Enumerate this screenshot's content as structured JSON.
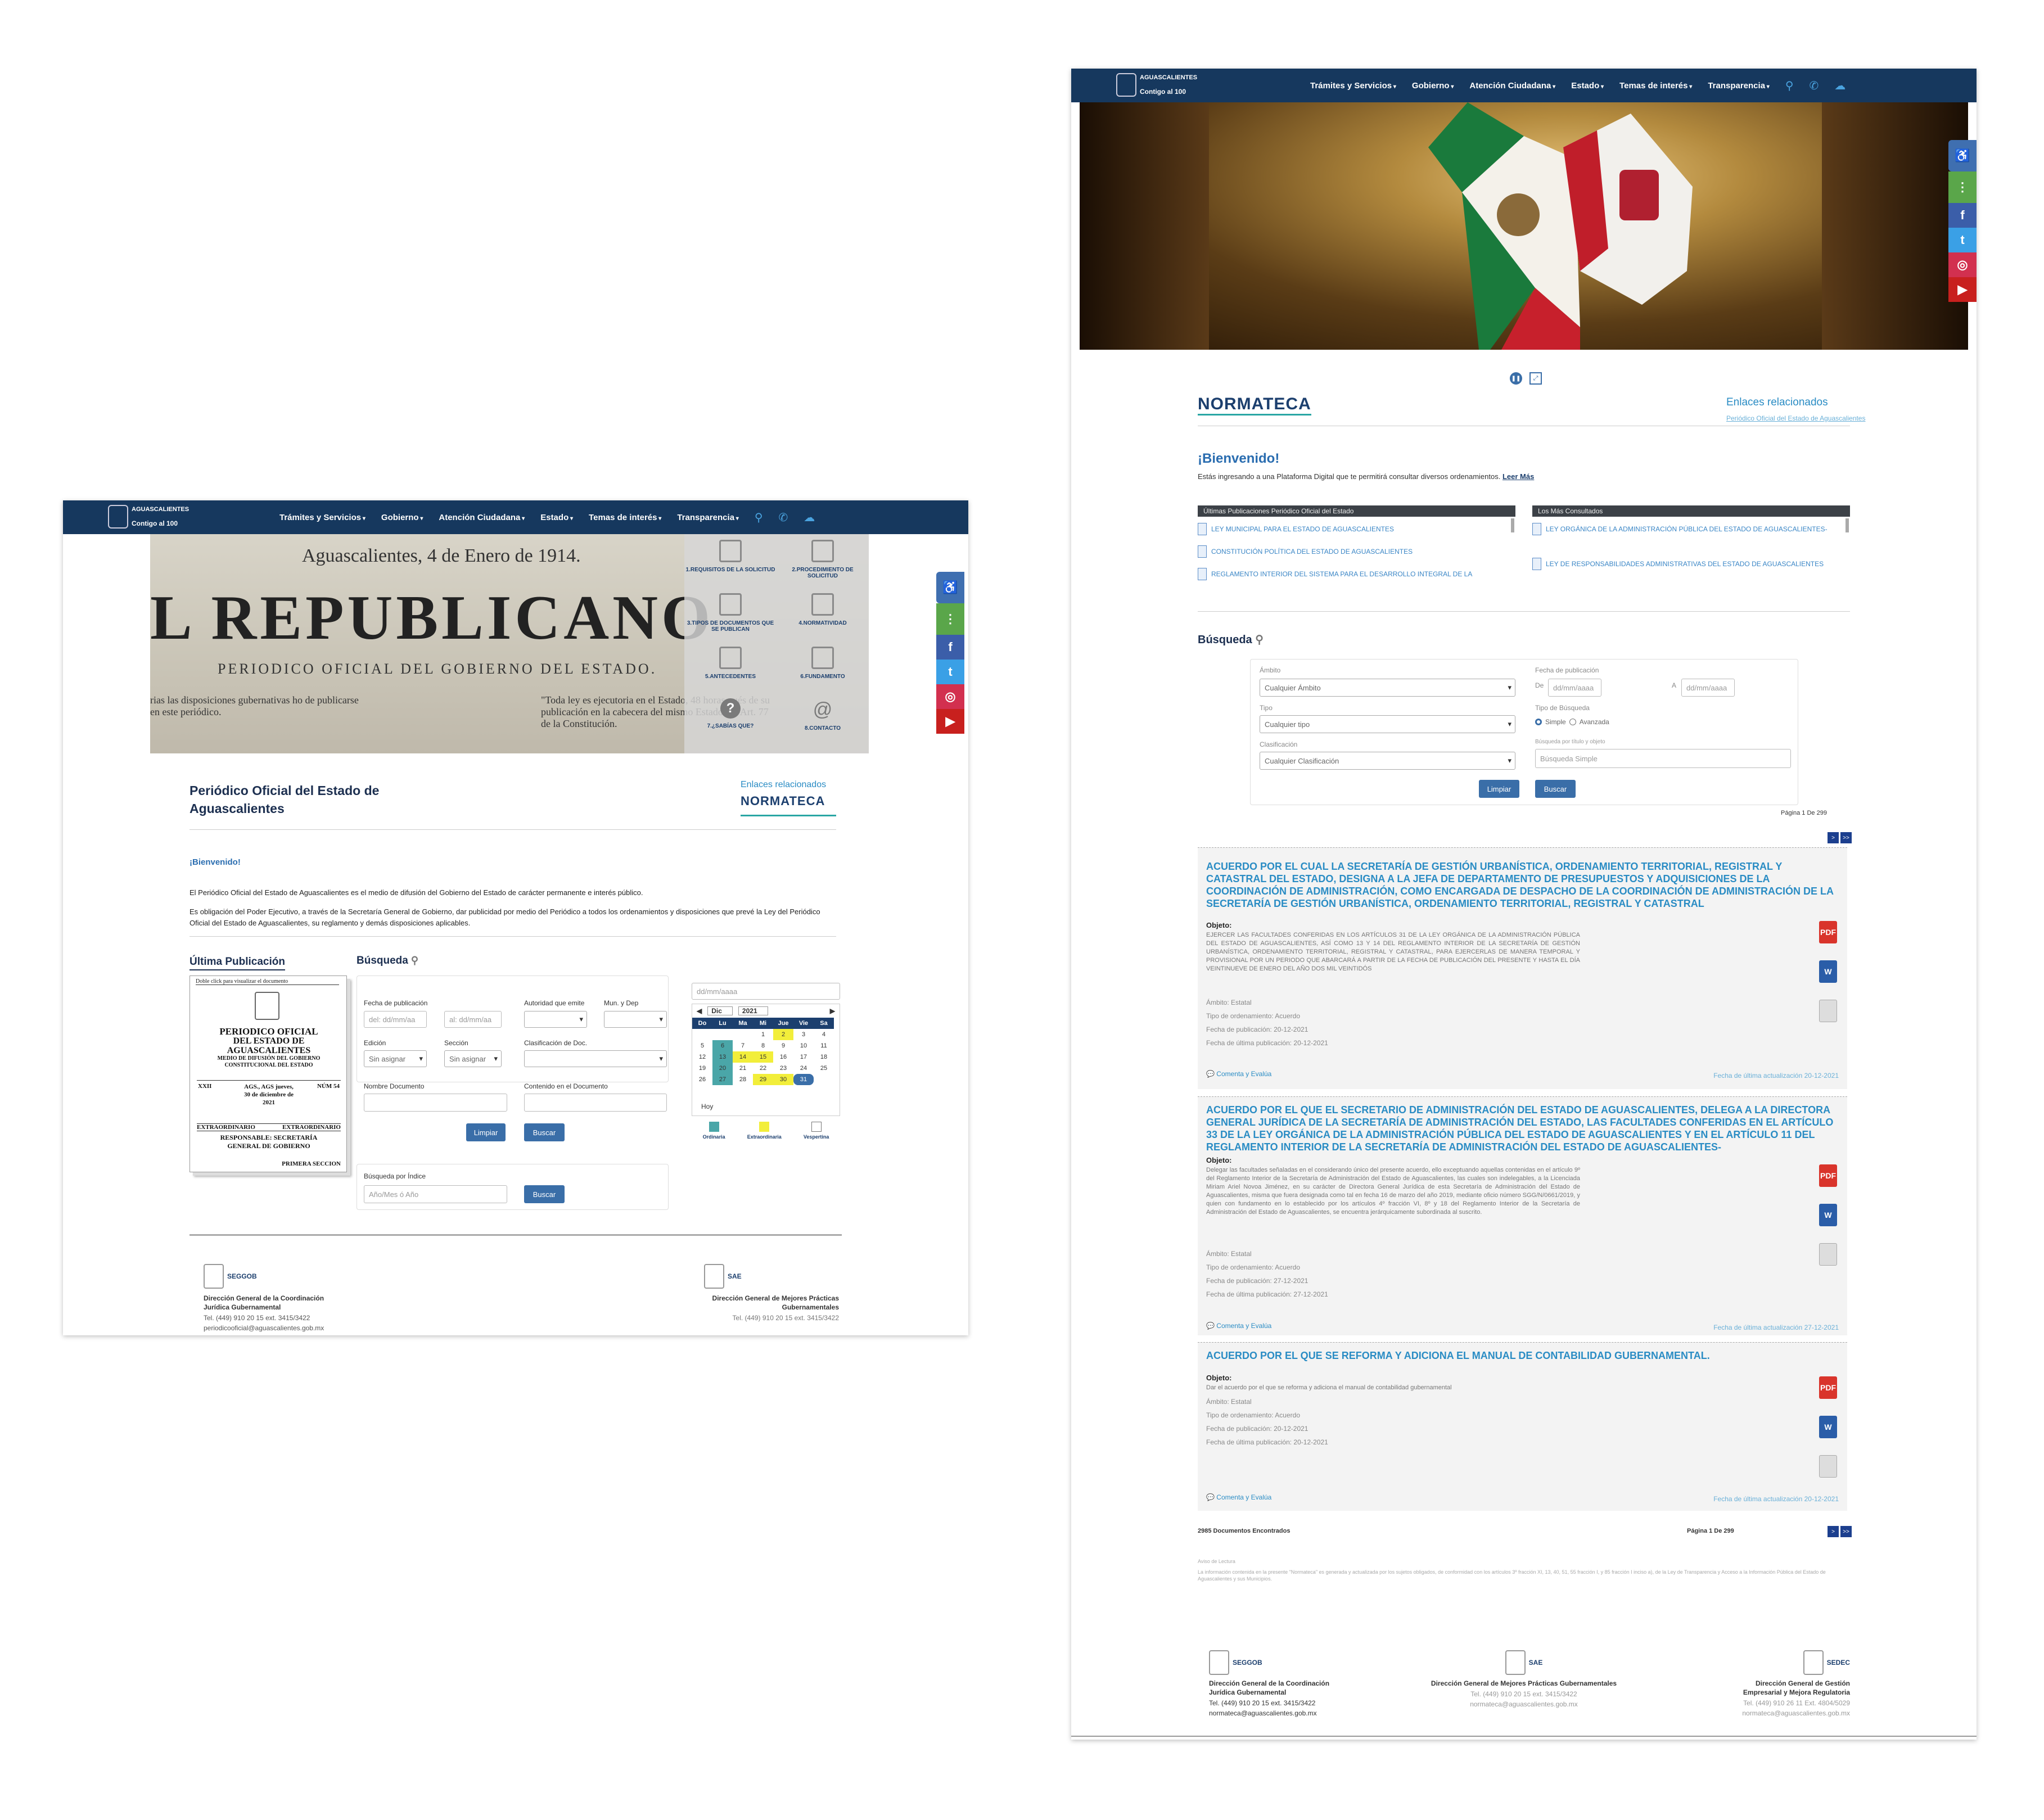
{
  "nav": {
    "brand_top": "AGUASCALIENTES",
    "brand_bottom": "Contigo al 100",
    "items": [
      "Trámites y Servicios",
      "Gobierno",
      "Atención Ciudadana",
      "Estado",
      "Temas de interés",
      "Transparencia"
    ]
  },
  "periodico": {
    "banner_date": "Aguascalientes, 4 de Enero de 1914.",
    "banner_head": "L REPUBLICANO",
    "banner_sub": "PERIODICO OFICIAL DEL GOBIERNO DEL ESTADO.",
    "banner_left": "rias las disposiciones gubernativas ho de publicarse en este periódico.",
    "banner_right": "\"Toda ley es ejecutoria en el Estado, 48 horas pués de su publicación en la cabecera del mismo Estado.\"—Art. 77 de la Constitución.",
    "tiles": [
      "1.REQUISITOS DE LA SOLICITUD",
      "2.PROCEDIMIENTO DE SOLICITUD",
      "3.TIPOS DE DOCUMENTOS QUE SE PUBLICAN",
      "4.NORMATIVIDAD",
      "5.ANTECEDENTES",
      "6.FUNDAMENTO",
      "7.¿SABÍAS QUE?",
      "8.CONTACTO"
    ],
    "title_line1": "Periódico Oficial del Estado de",
    "title_line2": "Aguascalientes",
    "related": "Enlaces relacionados",
    "normateca": "NORMATECA",
    "welcome": "¡Bienvenido!",
    "intro1": "El Periódico Oficial del Estado de Aguascalientes es el medio de difusión del Gobierno del Estado de carácter permanente e interés público.",
    "intro2": "Es obligación del Poder Ejecutivo, a través de la Secretaría General de Gobierno, dar publicidad por medio del Periódico a todos los ordenamientos y disposiciones que prevé la Ley del Periódico Oficial del Estado de Aguascalientes, su reglamento y demás disposiciones aplicables.",
    "ultima": "Última Publicación",
    "busqueda": "Búsqueda",
    "doc": {
      "hint": "Doble click para visualizar el documento",
      "t1": "PERIODICO OFICIAL",
      "t2": "DEL ESTADO DE",
      "t3": "AGUASCALIENTES",
      "t4": "MEDIO DE DIFUSIÓN DEL GOBIERNO CONSTITUCIONAL DEL ESTADO",
      "left": "XXII",
      "mid": "AGS., AGS jueves, 30 de diciembre de 2021",
      "right": "NÚM 54",
      "ext1": "EXTRAORDINARIO",
      "ext2": "EXTRAORDINARIO",
      "resp": "RESPONSABLE: SECRETARÍA GENERAL DE GOBIERNO",
      "sec": "PRIMERA SECCION"
    },
    "form": {
      "fecha_pub": "Fecha de publicación",
      "del": "del: dd/mm/aa",
      "al": "al: dd/mm/aa",
      "autoridad": "Autoridad que emite",
      "mun": "Mun. y Dep",
      "edicion": "Edición",
      "seccion": "Sección",
      "clasif": "Clasificación de Doc.",
      "sin": "Sin asignar",
      "nombre": "Nombre Documento",
      "contenido": "Contenido en el Documento",
      "limpiar": "Limpiar",
      "buscar": "Buscar",
      "indice": "Búsqueda por Índice",
      "indice_ph": "Año/Mes ó Año"
    },
    "cal": {
      "input": "dd/mm/aaaa",
      "month": "Dic",
      "year": "2021",
      "days": [
        "Do",
        "Lu",
        "Ma",
        "Mi",
        "Jue",
        "Vie",
        "Sa"
      ],
      "rows": [
        [
          "",
          "",
          "",
          "1",
          "2",
          "3",
          "4"
        ],
        [
          "5",
          "6",
          "7",
          "8",
          "9",
          "10",
          "11"
        ],
        [
          "12",
          "13",
          "14",
          "15",
          "16",
          "17",
          "18"
        ],
        [
          "19",
          "20",
          "21",
          "22",
          "23",
          "24",
          "25"
        ],
        [
          "26",
          "27",
          "28",
          "29",
          "30",
          "31",
          ""
        ]
      ],
      "hoy": "Hoy",
      "legend": [
        "Ordinaria",
        "Extraordinaria",
        "Vespertina"
      ],
      "colors": {
        "ordinaria": "#4aa6a8",
        "extra": "#f2ee3a",
        "vesp": "#ffffff"
      }
    },
    "footer": {
      "left_org": "SEGGOB",
      "left_title": "Dirección General de la Coordinación Jurídica Gubernamental",
      "left_tel": "Tel. (449) 910 20 15 ext. 3415/3422",
      "left_mail": "periodicooficial@aguascalientes.gob.mx",
      "right_org": "SAE",
      "right_title": "Dirección General de Mejores Prácticas Gubernamentales",
      "right_tel": "Tel. (449) 910 20 15 ext. 3415/3422"
    }
  },
  "normateca": {
    "logo": "NORMATECA",
    "related": "Enlaces relacionados",
    "related_link": "Periódico Oficial del Estado de Aguascalientes",
    "welcome": "¡Bienvenido!",
    "intro": "Estás ingresando a una Plataforma Digital que te permitirá consultar diversos ordenamientos.",
    "leer": "Leer Más",
    "list1_title": "Últimas Publicaciones Periódico Oficial del Estado",
    "list1": [
      "LEY MUNICIPAL PARA EL ESTADO DE AGUASCALIENTES",
      "CONSTITUCIÓN POLÍTICA DEL ESTADO DE AGUASCALIENTES",
      "REGLAMENTO INTERIOR DEL SISTEMA PARA EL DESARROLLO INTEGRAL DE LA"
    ],
    "list2_title": "Los Más Consultados",
    "list2": [
      "LEY ORGÁNICA DE LA ADMINISTRACIÓN PÚBLICA DEL ESTADO DE AGUASCALIENTES-",
      "LEY DE RESPONSABILIDADES ADMINISTRATIVAS DEL ESTADO DE AGUASCALIENTES"
    ],
    "busqueda": "Búsqueda",
    "form": {
      "ambito": "Ámbito",
      "ambito_v": "Cualquier Ámbito",
      "tipo": "Tipo",
      "tipo_v": "Cualquier tipo",
      "clasif": "Clasificación",
      "clasif_v": "Cualquier Clasificación",
      "fecha": "Fecha de publicación",
      "de": "De",
      "a": "A",
      "ph": "dd/mm/aaaa",
      "tipo_busq": "Tipo de Búsqueda",
      "simple": "Simple",
      "avanzada": "Avanzada",
      "busq_label": "Búsqueda por título y objeto",
      "busq_ph": "Búsqueda Simple",
      "limpiar": "Limpiar",
      "buscar": "Buscar"
    },
    "pagina_top": "Página 1 De 299",
    "results": [
      {
        "title": "ACUERDO POR EL CUAL LA SECRETARÍA DE GESTIÓN URBANÍSTICA, ORDENAMIENTO TERRITORIAL, REGISTRAL Y CATASTRAL DEL ESTADO, DESIGNA A LA JEFA DE DEPARTAMENTO DE PRESUPUESTOS Y ADQUISICIONES DE LA COORDINACIÓN DE ADMINISTRACIÓN, COMO ENCARGADA DE DESPACHO DE LA COORDINACIÓN DE ADMINISTRACIÓN DE LA SECRETARÍA DE GESTIÓN URBANÍSTICA, ORDENAMIENTO TERRITORIAL, REGISTRAL Y CATASTRAL",
        "objeto_label": "Objeto:",
        "objeto": "EJERCER LAS FACULTADES CONFERIDAS EN LOS ARTÍCULOS 31 DE LA LEY ORGÁNICA DE LA ADMINISTRACIÓN PÚBLICA DEL ESTADO DE AGUASCALIENTES, ASÍ COMO 13 Y 14 DEL REGLAMENTO INTERIOR DE LA SECRETARÍA DE GESTIÓN URBANÍSTICA, ORDENAMIENTO TERRITORIAL, REGISTRAL Y CATASTRAL, PARA EJERCERLAS DE MANERA TEMPORAL Y PROVISIONAL POR UN PERIODO QUE ABARCARÁ A PARTIR DE LA FECHA DE PUBLICACIÓN DEL PRESENTE Y HASTA EL DÍA VEINTINUEVE DE ENERO DEL AÑO DOS MIL VEINTIDÓS",
        "ambito": "Ámbito: Estatal",
        "tipo": "Tipo de ordenamiento: Acuerdo",
        "pub": "Fecha de publicación: 20-12-2021",
        "ult": "Fecha de última publicación: 20-12-2021",
        "comenta": "Comenta y Evalúa",
        "act": "Fecha de última actualización 20-12-2021"
      },
      {
        "title": "ACUERDO POR EL QUE EL SECRETARIO DE ADMINISTRACIÓN DEL ESTADO DE AGUASCALIENTES, DELEGA A LA DIRECTORA GENERAL JURÍDICA DE LA SECRETARÍA DE ADMINISTRACIÓN DEL ESTADO, LAS FACULTADES CONFERIDAS EN EL ARTÍCULO 33 DE LA LEY ORGÁNICA DE LA ADMINISTRACIÓN PÚBLICA DEL ESTADO DE AGUASCALIENTES Y EN EL ARTÍCULO 11 DEL REGLAMENTO INTERIOR DE LA SECRETARÍA DE ADMINISTRACIÓN DEL ESTADO DE AGUASCALIENTES-",
        "objeto_label": "Objeto:",
        "objeto": "Delegar las facultades señaladas en el considerando único del presente acuerdo, ello exceptuando aquellas contenidas en el artículo 9º del Reglamento Interior de la Secretaría de Administración del Estado de Aguascalientes, las cuales son indelegables, a la Licenciada Miriam Ariel Novoa Jiménez, en su carácter de Directora General Jurídica de esta Secretaría de Administración del Estado de Aguascalientes, misma que fuera designada como tal en fecha 16 de marzo del año 2019, mediante oficio número SGG/N/0661/2019, y quien con fundamento en lo establecido por los artículos 4º fracción VI, 8º y 18 del Reglamento Interior de la Secretaría de Administración del Estado de Aguascalientes, se encuentra jerárquicamente subordinada al suscrito.",
        "ambito": "Ámbito: Estatal",
        "tipo": "Tipo de ordenamiento: Acuerdo",
        "pub": "Fecha de publicación: 27-12-2021",
        "ult": "Fecha de última publicación: 27-12-2021",
        "comenta": "Comenta y Evalúa",
        "act": "Fecha de última actualización 27-12-2021"
      },
      {
        "title": "ACUERDO POR EL QUE SE REFORMA Y ADICIONA EL MANUAL DE CONTABILIDAD GUBERNAMENTAL.",
        "objeto_label": "Objeto:",
        "objeto": "Dar el acuerdo por el que se reforma y adiciona el manual de contabilidad gubernamental",
        "ambito": "Ámbito: Estatal",
        "tipo": "Tipo de ordenamiento: Acuerdo",
        "pub": "Fecha de publicación: 20-12-2021",
        "ult": "Fecha de última publicación: 20-12-2021",
        "comenta": "Comenta y Evalúa",
        "act": "Fecha de última actualización 20-12-2021"
      }
    ],
    "found": "2985 Documentos Encontrados",
    "pagina_bottom": "Página 1 De 299",
    "aviso": "Aviso de Lectura",
    "disclaimer": "La información contenida en la presente \"Normateca\" es generada y actualizada por los sujetos obligados, de conformidad con los artículos 3º fracción XI, 13, 40, 51, 55 fracción I, y 85 fracción I inciso a), de la Ley de Transparencia y Acceso a la Información Pública del Estado de Aguascalientes y sus Municipios.",
    "footer": [
      {
        "org": "SEGGOB",
        "title": "Dirección General de la Coordinación Jurídica Gubernamental",
        "tel": "Tel. (449) 910 20 15 ext. 3415/3422",
        "mail": "normateca@aguascalientes.gob.mx"
      },
      {
        "org": "SAE",
        "title": "Dirección General de Mejores Prácticas Gubernamentales",
        "tel": "Tel. (449) 910 20 15 ext. 3415/3422",
        "mail": "normateca@aguascalientes.gob.mx"
      },
      {
        "org": "SEDEC",
        "title": "Dirección General de Gestión Empresarial y Mejora Regulatoria",
        "tel": "Tel. (449) 910 26 11 Ext. 4804/5029",
        "mail": "normateca@aguascalientes.gob.mx"
      }
    ]
  }
}
